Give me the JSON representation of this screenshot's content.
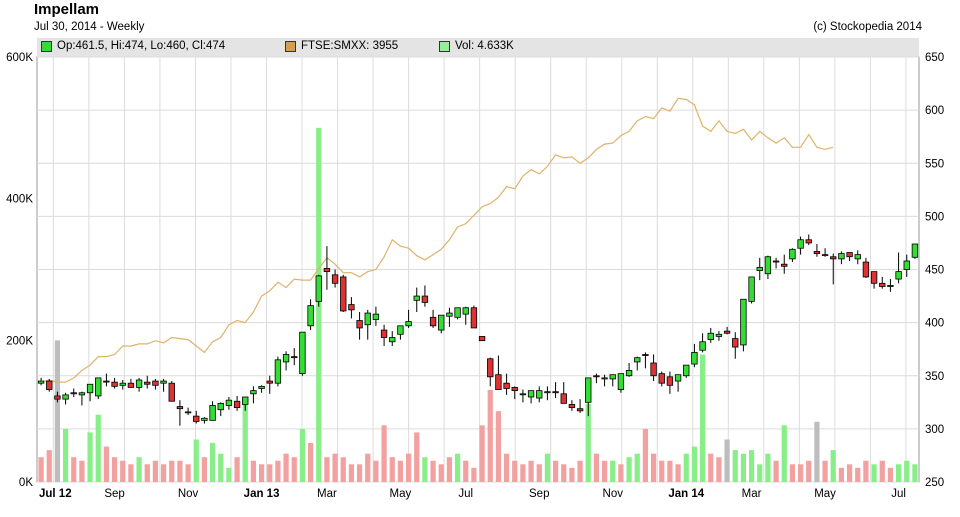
{
  "header": {
    "title": "Impellam",
    "subtitle": "Jul 30, 2014  -  Weekly",
    "credit": "(c) Stockopedia 2014"
  },
  "legend": [
    {
      "label": "Op:461.5, Hi:474, Lo:460, Cl:474",
      "color": "#33dd33"
    },
    {
      "label": "FTSE:SMXX: 3955",
      "color": "#d4a050"
    },
    {
      "label": "Vol: 4.633K",
      "color": "#99ee99"
    }
  ],
  "chart_data": {
    "type": "candlestick",
    "price_axis": {
      "min": 250,
      "max": 650,
      "ticks": [
        250,
        300,
        350,
        400,
        450,
        500,
        550,
        600,
        650
      ],
      "position": "right"
    },
    "volume_axis": {
      "min": 0,
      "max": 600000,
      "ticks": [
        0,
        200000,
        400000,
        600000
      ],
      "tick_labels": [
        "0K",
        "200K",
        "400K",
        "600K"
      ],
      "position": "left"
    },
    "x_labels": [
      {
        "week": 0,
        "label": "Jul 12",
        "bold": true
      },
      {
        "week": 9,
        "label": "Sep",
        "bold": false
      },
      {
        "week": 18,
        "label": "Nov",
        "bold": false
      },
      {
        "week": 27,
        "label": "Jan 13",
        "bold": true
      },
      {
        "week": 35,
        "label": "Mar",
        "bold": false
      },
      {
        "week": 44,
        "label": "May",
        "bold": false
      },
      {
        "week": 52,
        "label": "Jul",
        "bold": false
      },
      {
        "week": 61,
        "label": "Sep",
        "bold": false
      },
      {
        "week": 70,
        "label": "Nov",
        "bold": false
      },
      {
        "week": 79,
        "label": "Jan 14",
        "bold": true
      },
      {
        "week": 87,
        "label": "Mar",
        "bold": false
      },
      {
        "week": 96,
        "label": "May",
        "bold": false
      },
      {
        "week": 105,
        "label": "Jul",
        "bold": false
      }
    ],
    "grid": true,
    "ohlc": [
      [
        343,
        348,
        341,
        345
      ],
      [
        345,
        347,
        335,
        337
      ],
      [
        331,
        335,
        325,
        328
      ],
      [
        328,
        334,
        323,
        332
      ],
      [
        334,
        338,
        330,
        333
      ],
      [
        332,
        335,
        322,
        334
      ],
      [
        334,
        340,
        326,
        342
      ],
      [
        331,
        347,
        328,
        348
      ],
      [
        345,
        352,
        340,
        344
      ],
      [
        344,
        348,
        338,
        340
      ],
      [
        341,
        346,
        337,
        343
      ],
      [
        343,
        347,
        340,
        339
      ],
      [
        339,
        348,
        335,
        346
      ],
      [
        344,
        350,
        338,
        342
      ],
      [
        345,
        347,
        337,
        341
      ],
      [
        343,
        347,
        335,
        345
      ],
      [
        343,
        345,
        330,
        326
      ],
      [
        321,
        327,
        303,
        319
      ],
      [
        316,
        320,
        313,
        316
      ],
      [
        312,
        317,
        305,
        307
      ],
      [
        308,
        311,
        305,
        310
      ],
      [
        308,
        326,
        308,
        322
      ],
      [
        318,
        325,
        312,
        324
      ],
      [
        322,
        330,
        318,
        327
      ],
      [
        326,
        331,
        317,
        320
      ],
      [
        323,
        330,
        317,
        330
      ],
      [
        333,
        340,
        324,
        336
      ],
      [
        338,
        341,
        334,
        340
      ],
      [
        345,
        350,
        333,
        343
      ],
      [
        343,
        368,
        340,
        365
      ],
      [
        363,
        373,
        355,
        370
      ],
      [
        368,
        376,
        360,
        367
      ],
      [
        352,
        390,
        350,
        391
      ],
      [
        397,
        422,
        393,
        416
      ],
      [
        420,
        445,
        415,
        444
      ],
      [
        451,
        472,
        431,
        448
      ],
      [
        445,
        450,
        433,
        437
      ],
      [
        443,
        445,
        410,
        411
      ],
      [
        417,
        424,
        404,
        412
      ],
      [
        402,
        410,
        384,
        395
      ],
      [
        398,
        412,
        384,
        409
      ],
      [
        403,
        415,
        397,
        408
      ],
      [
        393,
        398,
        378,
        386
      ],
      [
        382,
        392,
        378,
        386
      ],
      [
        389,
        396,
        384,
        397
      ],
      [
        397,
        412,
        395,
        401
      ],
      [
        421,
        433,
        410,
        425
      ],
      [
        425,
        435,
        415,
        419
      ],
      [
        405,
        412,
        395,
        397
      ],
      [
        393,
        404,
        390,
        407
      ],
      [
        406,
        414,
        396,
        409
      ],
      [
        405,
        414,
        403,
        414
      ],
      [
        408,
        415,
        398,
        414
      ],
      [
        414,
        416,
        395,
        395
      ],
      [
        387,
        384,
        383,
        383
      ],
      [
        366,
        367,
        340,
        349
      ],
      [
        351,
        369,
        340,
        337
      ],
      [
        343,
        352,
        332,
        338
      ],
      [
        339,
        340,
        328,
        336
      ],
      [
        333,
        337,
        325,
        333
      ],
      [
        330,
        335,
        324,
        336
      ],
      [
        329,
        340,
        325,
        336
      ],
      [
        334,
        340,
        327,
        335
      ],
      [
        335,
        344,
        329,
        334
      ],
      [
        333,
        344,
        325,
        324
      ],
      [
        323,
        327,
        317,
        320
      ],
      [
        319,
        328,
        315,
        317
      ],
      [
        325,
        348,
        312,
        348
      ],
      [
        350,
        352,
        343,
        349
      ],
      [
        347,
        351,
        340,
        348
      ],
      [
        347,
        350,
        340,
        351
      ],
      [
        337,
        351,
        334,
        352
      ],
      [
        350,
        362,
        349,
        355
      ],
      [
        363,
        368,
        355,
        367
      ],
      [
        370,
        372,
        357,
        369
      ],
      [
        362,
        370,
        345,
        350
      ],
      [
        352,
        354,
        340,
        343
      ],
      [
        349,
        354,
        333,
        341
      ],
      [
        345,
        350,
        335,
        351
      ],
      [
        350,
        358,
        348,
        360
      ],
      [
        361,
        380,
        358,
        372
      ],
      [
        374,
        390,
        372,
        382
      ],
      [
        384,
        395,
        381,
        390
      ],
      [
        387,
        392,
        383,
        389
      ],
      [
        392,
        396,
        389,
        390
      ],
      [
        385,
        391,
        366,
        377
      ],
      [
        379,
        422,
        373,
        422
      ],
      [
        420,
        443,
        418,
        443
      ],
      [
        449,
        461,
        440,
        452
      ],
      [
        446,
        463,
        441,
        462
      ],
      [
        458,
        461,
        451,
        457
      ],
      [
        455,
        464,
        446,
        453
      ],
      [
        460,
        470,
        457,
        469
      ],
      [
        470,
        481,
        464,
        478
      ],
      [
        478,
        483,
        473,
        475
      ],
      [
        467,
        474,
        462,
        465
      ],
      [
        464,
        470,
        462,
        464
      ],
      [
        462,
        465,
        436,
        460
      ],
      [
        460,
        467,
        455,
        465
      ],
      [
        466,
        466,
        458,
        462
      ],
      [
        460,
        468,
        455,
        464
      ],
      [
        457,
        461,
        442,
        443
      ],
      [
        448,
        445,
        432,
        437
      ],
      [
        437,
        443,
        432,
        434
      ],
      [
        434,
        441,
        429,
        435
      ],
      [
        441,
        466,
        437,
        448
      ],
      [
        450,
        464,
        443,
        458
      ],
      [
        461.5,
        474,
        460,
        474
      ]
    ],
    "benchmark": [
      344,
      346,
      344,
      344,
      348,
      355,
      360,
      368,
      368,
      370,
      378,
      378,
      380,
      380,
      383,
      381,
      386,
      385,
      384,
      378,
      372,
      382,
      386,
      398,
      402,
      400,
      410,
      425,
      430,
      438,
      433,
      441,
      440,
      440,
      451,
      461,
      455,
      447,
      447,
      443,
      448,
      450,
      462,
      478,
      472,
      470,
      463,
      459,
      464,
      469,
      478,
      490,
      493,
      501,
      509,
      512,
      518,
      528,
      526,
      538,
      544,
      540,
      547,
      558,
      555,
      556,
      550,
      555,
      563,
      568,
      569,
      576,
      580,
      590,
      594,
      592,
      602,
      599,
      611,
      610,
      605,
      585,
      580,
      590,
      580,
      578,
      582,
      572,
      580,
      574,
      569,
      574,
      565,
      565,
      577,
      565,
      563,
      565
    ],
    "volume": [
      [
        35000,
        "r"
      ],
      [
        45000,
        "r"
      ],
      [
        200000,
        "x"
      ],
      [
        75000,
        "g"
      ],
      [
        35000,
        "r"
      ],
      [
        30000,
        "r"
      ],
      [
        70000,
        "g"
      ],
      [
        95000,
        "g"
      ],
      [
        50000,
        "r"
      ],
      [
        35000,
        "r"
      ],
      [
        30000,
        "r"
      ],
      [
        25000,
        "r"
      ],
      [
        35000,
        "g"
      ],
      [
        25000,
        "r"
      ],
      [
        30000,
        "r"
      ],
      [
        25000,
        "r"
      ],
      [
        30000,
        "r"
      ],
      [
        30000,
        "r"
      ],
      [
        25000,
        "r"
      ],
      [
        60000,
        "g"
      ],
      [
        35000,
        "r"
      ],
      [
        55000,
        "g"
      ],
      [
        40000,
        "g"
      ],
      [
        20000,
        "g"
      ],
      [
        35000,
        "r"
      ],
      [
        120000,
        "g"
      ],
      [
        30000,
        "r"
      ],
      [
        25000,
        "r"
      ],
      [
        25000,
        "r"
      ],
      [
        30000,
        "r"
      ],
      [
        40000,
        "r"
      ],
      [
        35000,
        "r"
      ],
      [
        75000,
        "g"
      ],
      [
        55000,
        "r"
      ],
      [
        500000,
        "g"
      ],
      [
        35000,
        "r"
      ],
      [
        40000,
        "r"
      ],
      [
        35000,
        "r"
      ],
      [
        25000,
        "r"
      ],
      [
        25000,
        "r"
      ],
      [
        40000,
        "r"
      ],
      [
        30000,
        "r"
      ],
      [
        80000,
        "r"
      ],
      [
        35000,
        "r"
      ],
      [
        30000,
        "r"
      ],
      [
        40000,
        "r"
      ],
      [
        70000,
        "r"
      ],
      [
        35000,
        "g"
      ],
      [
        30000,
        "r"
      ],
      [
        25000,
        "r"
      ],
      [
        35000,
        "r"
      ],
      [
        40000,
        "g"
      ],
      [
        30000,
        "r"
      ],
      [
        20000,
        "r"
      ],
      [
        80000,
        "r"
      ],
      [
        130000,
        "r"
      ],
      [
        100000,
        "r"
      ],
      [
        40000,
        "r"
      ],
      [
        30000,
        "r"
      ],
      [
        25000,
        "r"
      ],
      [
        30000,
        "r"
      ],
      [
        25000,
        "r"
      ],
      [
        40000,
        "g"
      ],
      [
        30000,
        "r"
      ],
      [
        25000,
        "r"
      ],
      [
        20000,
        "r"
      ],
      [
        30000,
        "r"
      ],
      [
        110000,
        "g"
      ],
      [
        40000,
        "r"
      ],
      [
        30000,
        "r"
      ],
      [
        30000,
        "g"
      ],
      [
        25000,
        "r"
      ],
      [
        35000,
        "g"
      ],
      [
        40000,
        "g"
      ],
      [
        75000,
        "r"
      ],
      [
        40000,
        "r"
      ],
      [
        30000,
        "r"
      ],
      [
        30000,
        "r"
      ],
      [
        25000,
        "r"
      ],
      [
        40000,
        "g"
      ],
      [
        50000,
        "g"
      ],
      [
        180000,
        "g"
      ],
      [
        40000,
        "r"
      ],
      [
        35000,
        "r"
      ],
      [
        60000,
        "x"
      ],
      [
        45000,
        "g"
      ],
      [
        40000,
        "g"
      ],
      [
        45000,
        "g"
      ],
      [
        25000,
        "g"
      ],
      [
        40000,
        "g"
      ],
      [
        30000,
        "r"
      ],
      [
        80000,
        "g"
      ],
      [
        25000,
        "r"
      ],
      [
        25000,
        "r"
      ],
      [
        30000,
        "r"
      ],
      [
        85000,
        "x"
      ],
      [
        30000,
        "r"
      ],
      [
        45000,
        "g"
      ],
      [
        20000,
        "r"
      ],
      [
        25000,
        "r"
      ],
      [
        20000,
        "r"
      ],
      [
        30000,
        "r"
      ],
      [
        25000,
        "g"
      ],
      [
        30000,
        "r"
      ],
      [
        20000,
        "r"
      ],
      [
        25000,
        "g"
      ],
      [
        30000,
        "g"
      ],
      [
        25000,
        "g"
      ]
    ]
  }
}
